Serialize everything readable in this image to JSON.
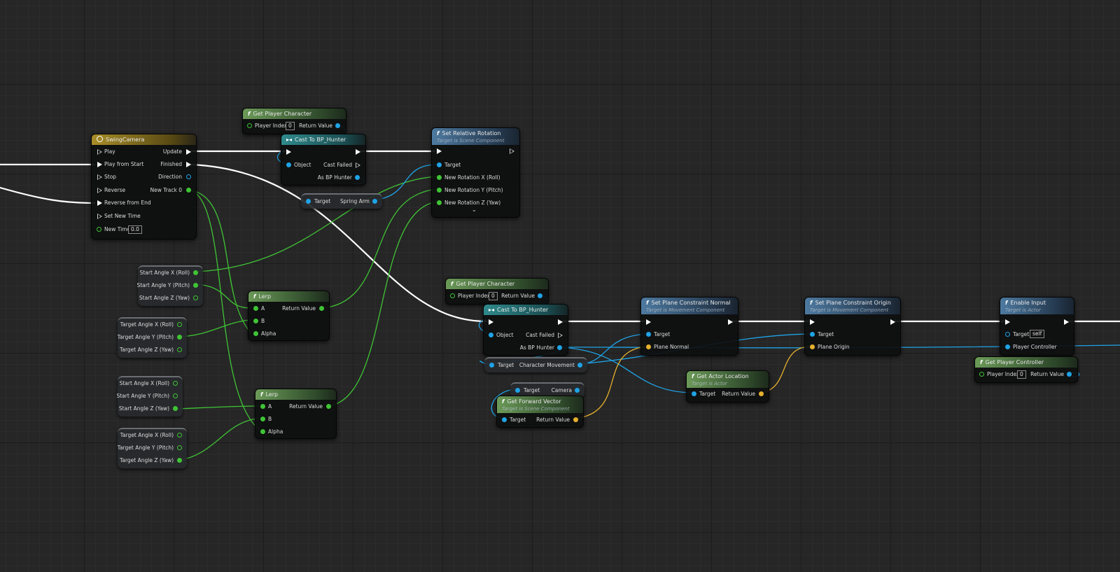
{
  "nodes": {
    "swing_camera": {
      "title": "SwingCamera",
      "inputs": [
        "Play",
        "Play from Start",
        "Stop",
        "Reverse",
        "Reverse from End",
        "Set New Time",
        "New Time"
      ],
      "new_time_value": "0.0",
      "outputs": [
        "Update",
        "Finished",
        "Direction",
        "New Track 0"
      ]
    },
    "get_player_character_1": {
      "title": "Get Player Character",
      "player_index_label": "Player Index",
      "player_index_value": "0",
      "return_label": "Return Value"
    },
    "cast_to_bp_hunter_1": {
      "title": "Cast To BP_Hunter",
      "object_label": "Object",
      "cast_failed_label": "Cast Failed",
      "as_label": "As BP Hunter"
    },
    "spring_arm_getter": {
      "target_label": "Target",
      "output_label": "Spring Arm"
    },
    "set_relative_rotation": {
      "title": "Set Relative Rotation",
      "subtitle": "Target is Scene Component",
      "pins": [
        "Target",
        "New Rotation X (Roll)",
        "New Rotation Y (Pitch)",
        "New Rotation Z (Yaw)"
      ]
    },
    "start_angle_1": {
      "pins": [
        "Start Angle X (Roll)",
        "Start Angle Y (Pitch)",
        "Start Angle Z (Yaw)"
      ]
    },
    "target_angle_1": {
      "pins": [
        "Target Angle X (Roll)",
        "Target Angle Y (Pitch)",
        "Target Angle Z (Yaw)"
      ]
    },
    "lerp_1": {
      "title": "Lerp",
      "a": "A",
      "b": "B",
      "alpha": "Alpha",
      "ret": "Return Value"
    },
    "start_angle_2": {
      "pins": [
        "Start Angle X (Roll)",
        "Start Angle Y (Pitch)",
        "Start Angle Z (Yaw)"
      ]
    },
    "target_angle_2": {
      "pins": [
        "Target Angle X (Roll)",
        "Target Angle Y (Pitch)",
        "Target Angle Z (Yaw)"
      ]
    },
    "lerp_2": {
      "title": "Lerp",
      "a": "A",
      "b": "B",
      "alpha": "Alpha",
      "ret": "Return Value"
    },
    "get_player_character_2": {
      "title": "Get Player Character",
      "player_index_label": "Player Index",
      "player_index_value": "0",
      "return_label": "Return Value"
    },
    "cast_to_bp_hunter_2": {
      "title": "Cast To BP_Hunter",
      "object_label": "Object",
      "cast_failed_label": "Cast Failed",
      "as_label": "As BP Hunter"
    },
    "char_movement_getter": {
      "target_label": "Target",
      "output_label": "Character Movement"
    },
    "camera_getter": {
      "target_label": "Target",
      "output_label": "Camera"
    },
    "get_forward_vector": {
      "title": "Get Forward Vector",
      "subtitle": "Target is Scene Component",
      "target_label": "Target",
      "ret": "Return Value"
    },
    "set_plane_constraint_normal": {
      "title": "Set Plane Constraint Normal",
      "subtitle": "Target is Movement Component",
      "target_label": "Target",
      "pin2": "Plane Normal"
    },
    "get_actor_location": {
      "title": "Get Actor Location",
      "subtitle": "Target is Actor",
      "target_label": "Target",
      "ret": "Return Value"
    },
    "set_plane_constraint_origin": {
      "title": "Set Plane Constraint Origin",
      "subtitle": "Target is Movement Component",
      "target_label": "Target",
      "pin2": "Plane Origin"
    },
    "enable_input": {
      "title": "Enable Input",
      "subtitle": "Target is Actor",
      "target_label": "Target",
      "target_value": "self",
      "pin2": "Player Controller"
    },
    "get_player_controller": {
      "title": "Get Player Controller",
      "player_index_label": "Player Index",
      "player_index_value": "0",
      "return_label": "Return Value"
    }
  },
  "colors": {
    "exec_wire": "#ffffff",
    "float_wire": "#3fc435",
    "object_wire": "#1fa3e6",
    "vector_wire": "#e5b02e"
  }
}
